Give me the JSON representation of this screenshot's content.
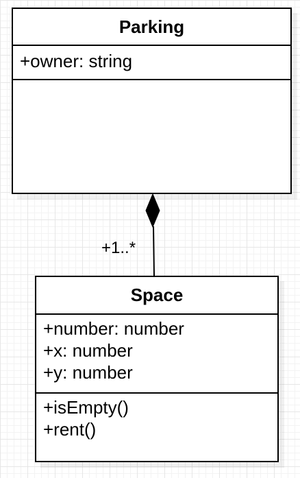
{
  "diagram": {
    "classes": {
      "parking": {
        "name": "Parking",
        "attributes": [
          "+owner: string"
        ],
        "methods": []
      },
      "space": {
        "name": "Space",
        "attributes": [
          "+number: number",
          "+x: number",
          "+y: number"
        ],
        "methods": [
          "+isEmpty()",
          "+rent()"
        ]
      }
    },
    "relationship": {
      "type": "composition",
      "whole": "Parking",
      "part": "Space",
      "multiplicity": "+1..*"
    },
    "colors": {
      "stroke": "#000000",
      "fill": "#ffffff"
    }
  }
}
